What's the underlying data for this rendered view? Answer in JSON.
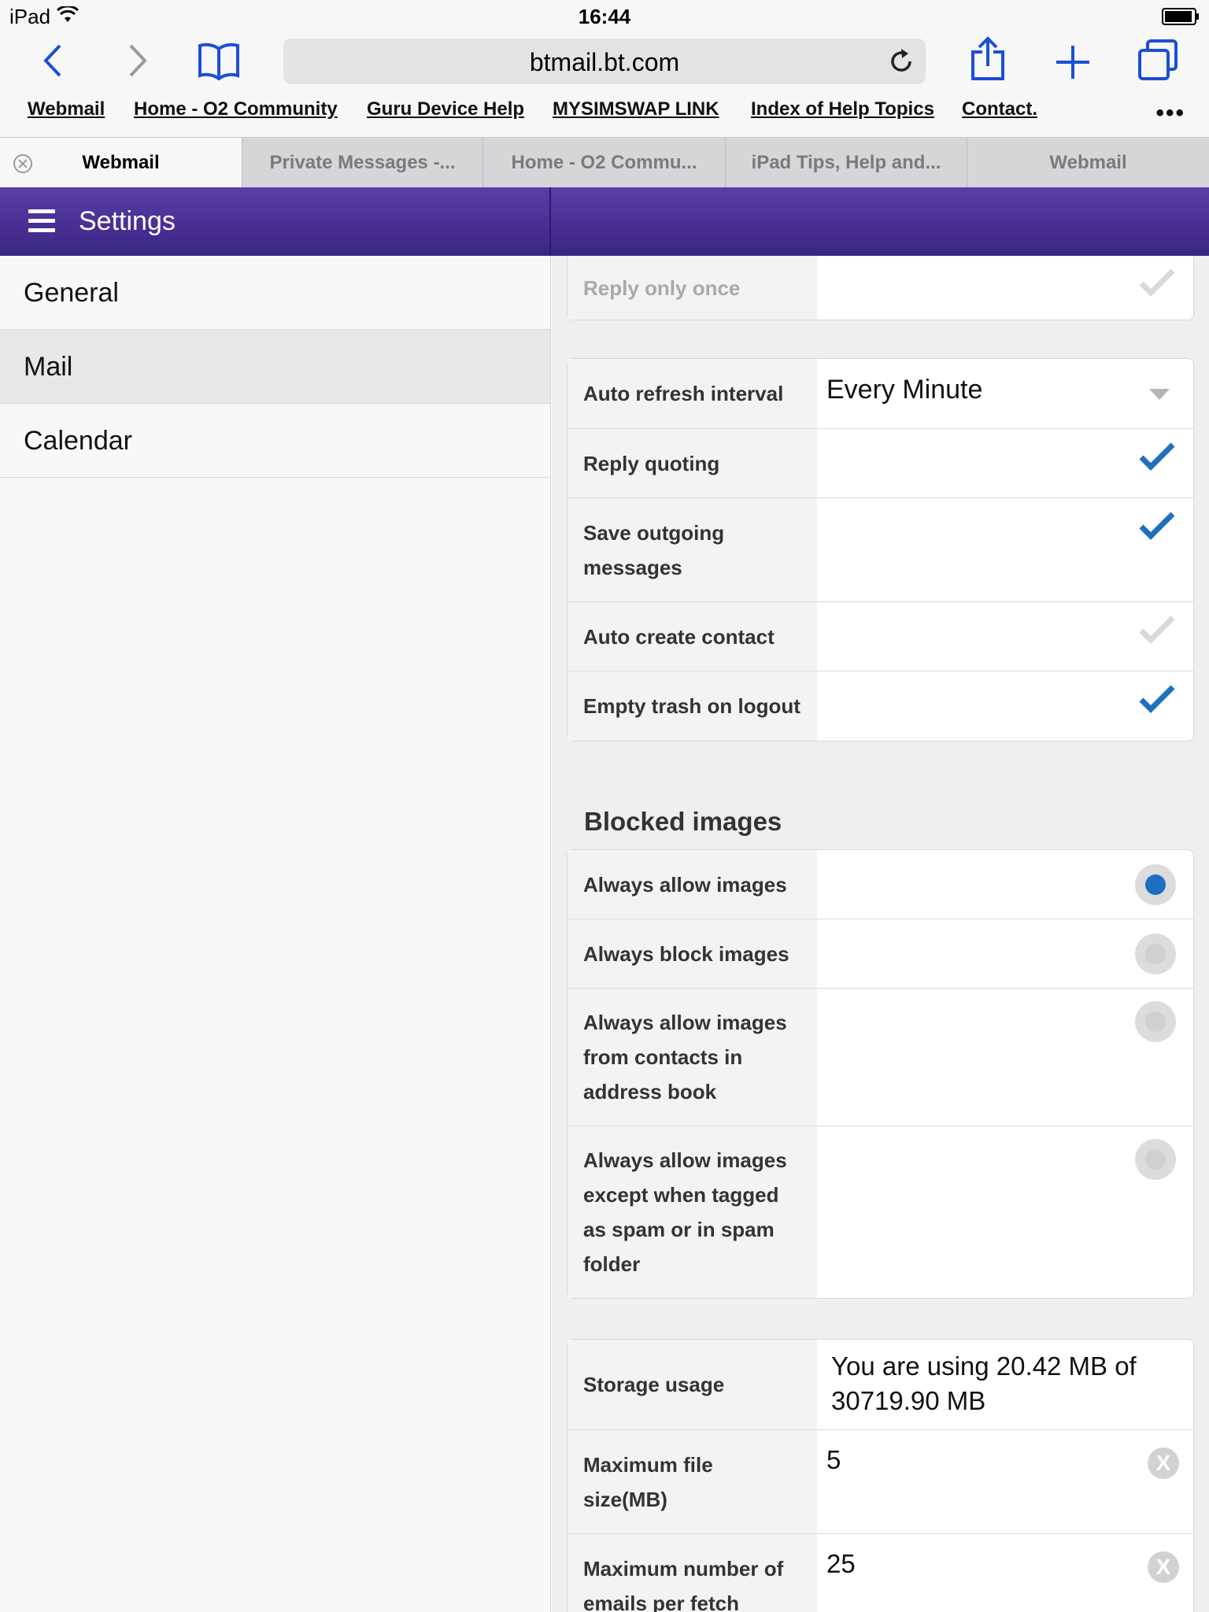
{
  "status_bar": {
    "device": "iPad",
    "time": "16:44"
  },
  "browser": {
    "url": "btmail.bt.com",
    "bookmarks": [
      "Webmail",
      "Home - O2 Community",
      "Guru Device Help",
      "MYSIMSWAP LINK",
      "Index of Help Topics",
      "Contact."
    ],
    "more": "•••",
    "tabs": [
      {
        "label": "Webmail",
        "active": true
      },
      {
        "label": "Private Messages -...",
        "active": false
      },
      {
        "label": "Home - O2 Commu...",
        "active": false
      },
      {
        "label": "iPad Tips, Help and...",
        "active": false
      },
      {
        "label": "Webmail",
        "active": false
      }
    ]
  },
  "header": {
    "title": "Settings"
  },
  "nav": {
    "items": [
      "General",
      "Mail",
      "Calendar"
    ],
    "selected": "Mail"
  },
  "settings": {
    "reply_only_once": {
      "label": "Reply only once",
      "checked": false
    },
    "auto_refresh": {
      "label": "Auto refresh interval",
      "value": "Every Minute"
    },
    "reply_quoting": {
      "label": "Reply quoting",
      "checked": true
    },
    "save_outgoing": {
      "label": "Save outgoing messages",
      "checked": true
    },
    "auto_create_contact": {
      "label": "Auto create contact",
      "checked": false
    },
    "empty_trash": {
      "label": "Empty trash on logout",
      "checked": true
    }
  },
  "blocked_images": {
    "title": "Blocked images",
    "options": [
      {
        "label": "Always allow images",
        "selected": true
      },
      {
        "label": "Always block images",
        "selected": false
      },
      {
        "label": "Always allow images from contacts in address book",
        "selected": false
      },
      {
        "label": "Always allow images except when tagged as spam or in spam folder",
        "selected": false
      }
    ]
  },
  "storage": {
    "usage_label": "Storage usage",
    "usage_value": "You are using 20.42 MB of 30719.90 MB",
    "max_file_label": "Maximum file size(MB)",
    "max_file_value": "5",
    "max_emails_label": "Maximum number of emails per fetch",
    "max_emails_value": "25",
    "clear_glyph": "X"
  },
  "colors": {
    "accent": "#1f6fc1",
    "header": "#4a3299",
    "ios_blue": "#1a4fd6"
  }
}
